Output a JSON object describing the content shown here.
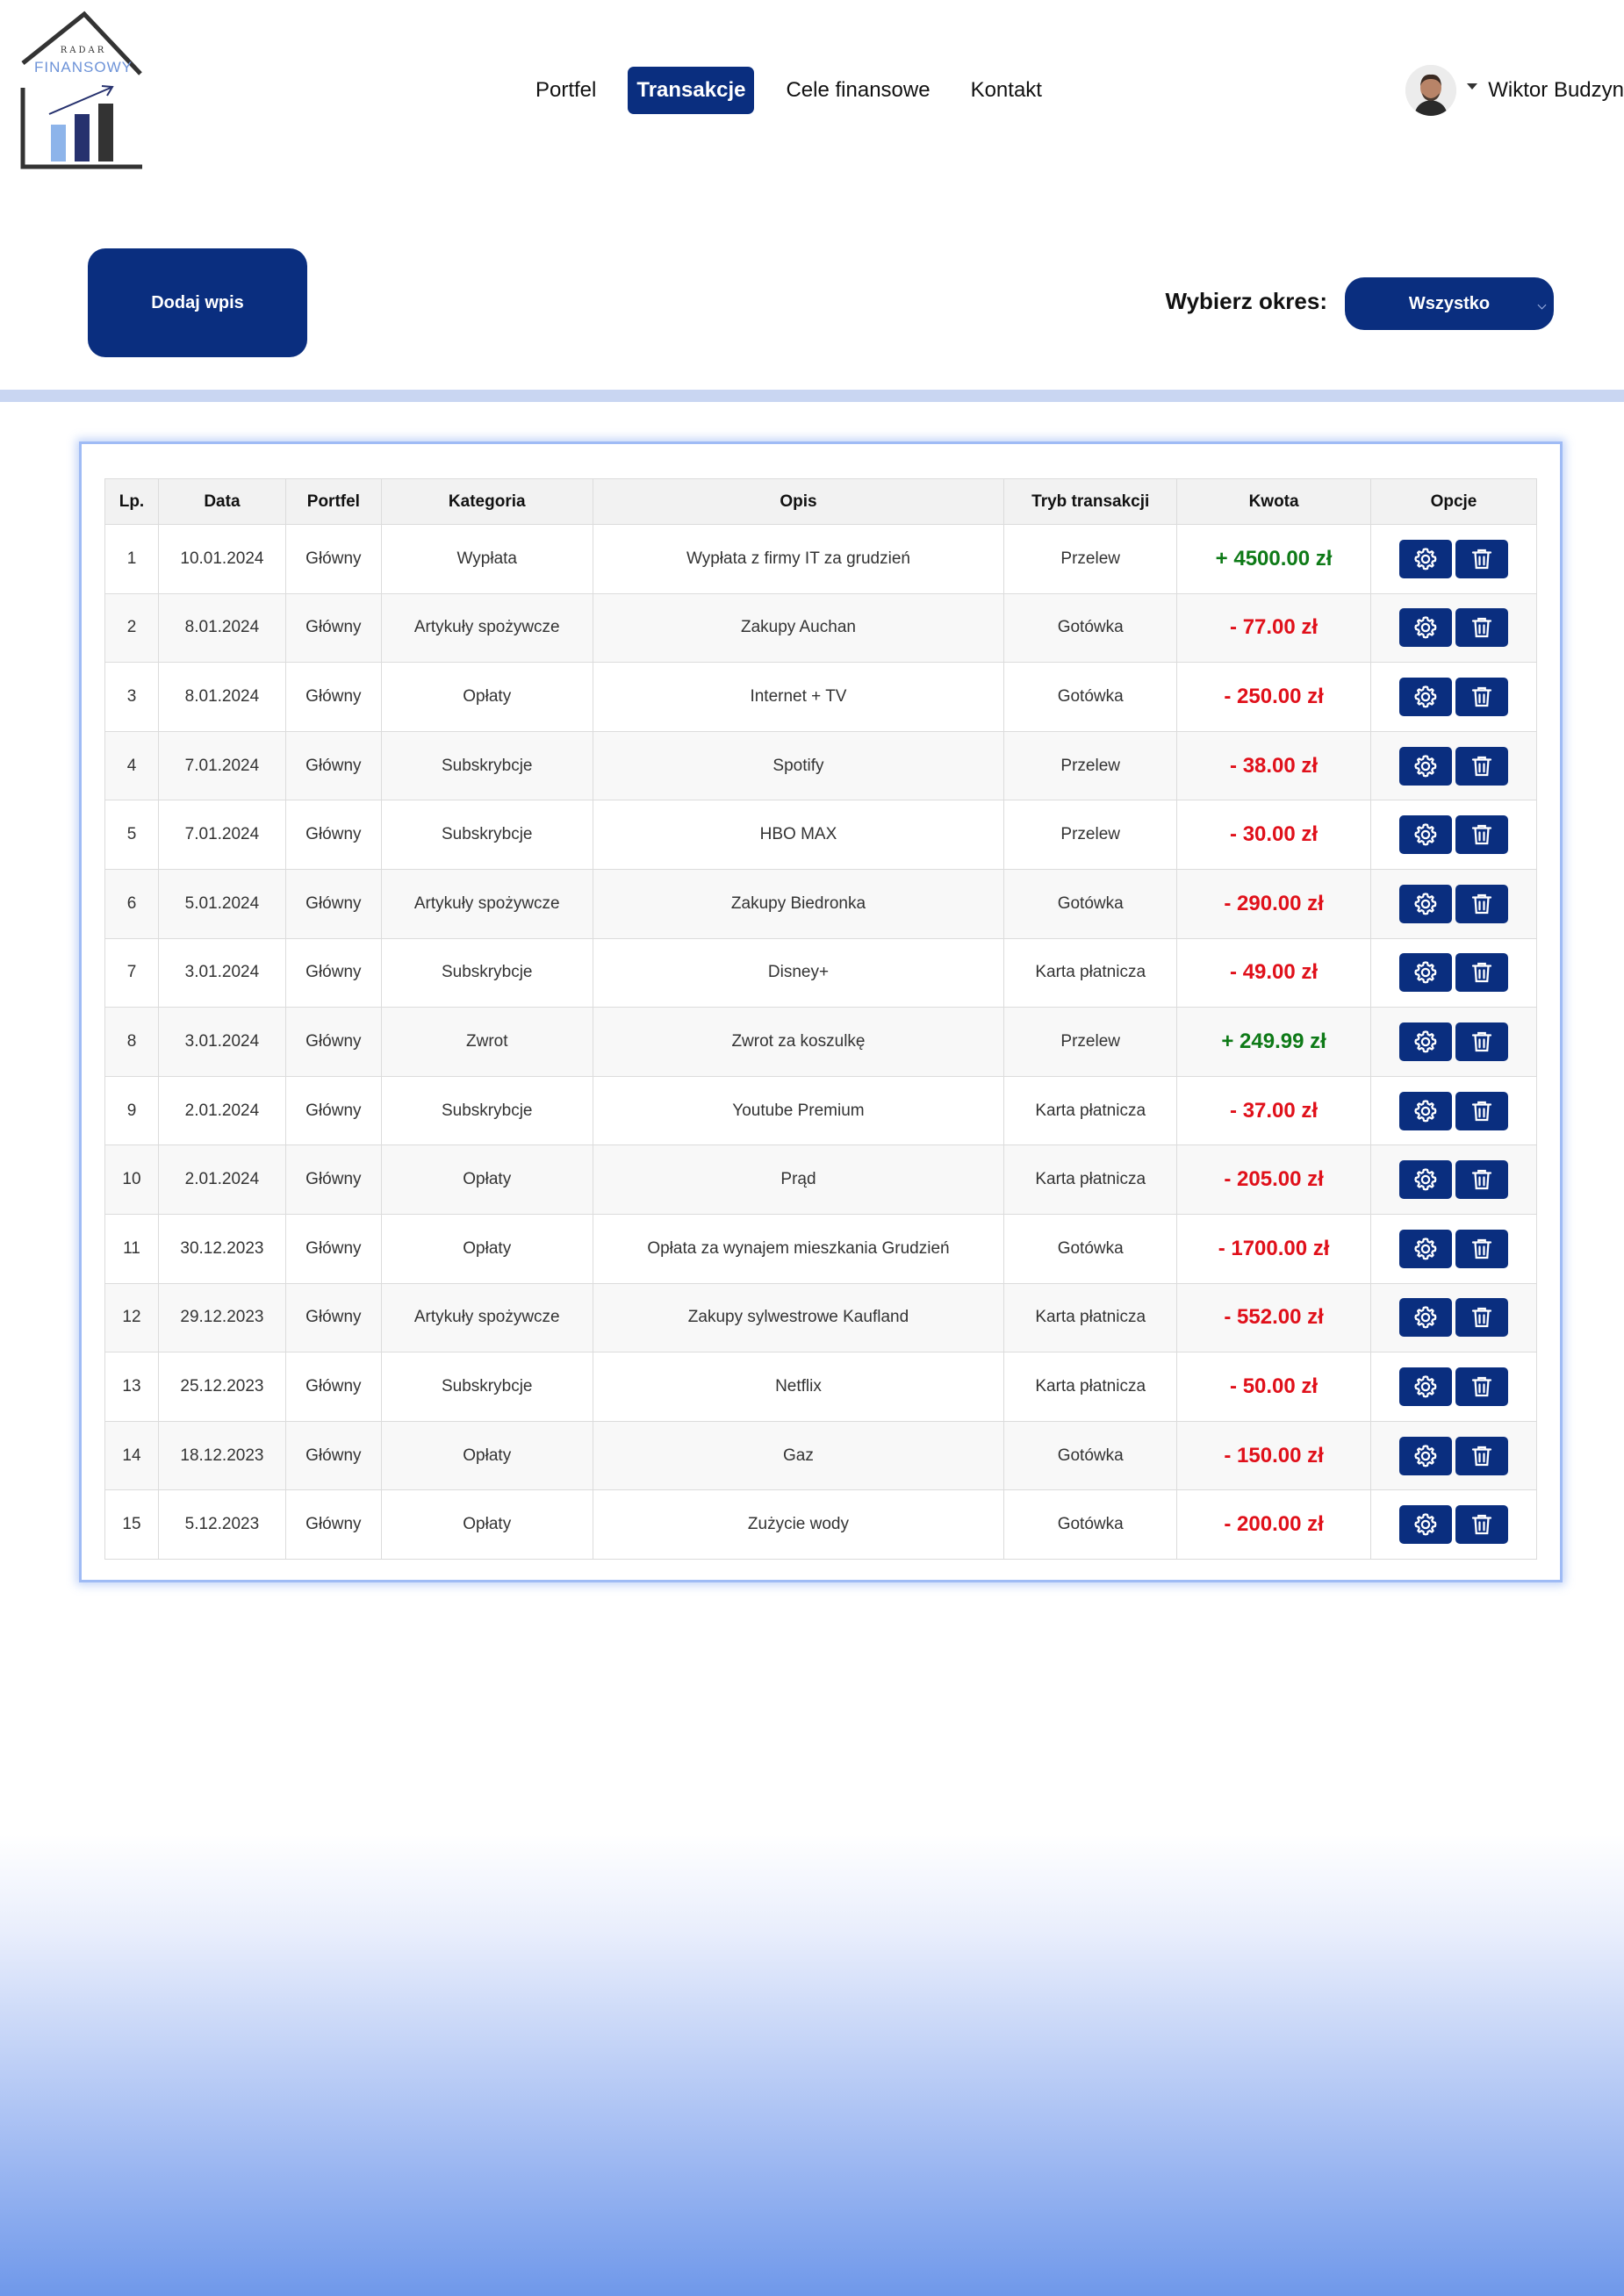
{
  "logo": {
    "top_text": "RADAR",
    "brand_text": "FINANSOWY"
  },
  "nav": {
    "items": [
      {
        "label": "Portfel",
        "active": false
      },
      {
        "label": "Transakcje",
        "active": true
      },
      {
        "label": "Cele finansowe",
        "active": false
      },
      {
        "label": "Kontakt",
        "active": false
      }
    ]
  },
  "user": {
    "name": "Wiktor Budzyn",
    "avatar_icon": "user-avatar"
  },
  "controls": {
    "add_label": "Dodaj wpis",
    "period_label": "Wybierz okres:",
    "period_selected": "Wszystko"
  },
  "colors": {
    "primary": "#0a2e7f",
    "positive": "#0e7a17",
    "negative": "#e0101a",
    "divider": "#c9d6f2"
  },
  "table": {
    "headers": [
      "Lp.",
      "Data",
      "Portfel",
      "Kategoria",
      "Opis",
      "Tryb transakcji",
      "Kwota",
      "Opcje"
    ],
    "rows": [
      {
        "lp": "1",
        "date": "10.01.2024",
        "wallet": "Główny",
        "category": "Wypłata",
        "desc": "Wypłata z firmy IT za grudzień",
        "mode": "Przelew",
        "amount": "+ 4500.00 zł",
        "sign": "pos"
      },
      {
        "lp": "2",
        "date": "8.01.2024",
        "wallet": "Główny",
        "category": "Artykuły spożywcze",
        "desc": "Zakupy Auchan",
        "mode": "Gotówka",
        "amount": "- 77.00 zł",
        "sign": "neg"
      },
      {
        "lp": "3",
        "date": "8.01.2024",
        "wallet": "Główny",
        "category": "Opłaty",
        "desc": "Internet + TV",
        "mode": "Gotówka",
        "amount": "- 250.00 zł",
        "sign": "neg"
      },
      {
        "lp": "4",
        "date": "7.01.2024",
        "wallet": "Główny",
        "category": "Subskrybcje",
        "desc": "Spotify",
        "mode": "Przelew",
        "amount": "- 38.00 zł",
        "sign": "neg"
      },
      {
        "lp": "5",
        "date": "7.01.2024",
        "wallet": "Główny",
        "category": "Subskrybcje",
        "desc": "HBO MAX",
        "mode": "Przelew",
        "amount": "- 30.00 zł",
        "sign": "neg"
      },
      {
        "lp": "6",
        "date": "5.01.2024",
        "wallet": "Główny",
        "category": "Artykuły spożywcze",
        "desc": "Zakupy Biedronka",
        "mode": "Gotówka",
        "amount": "- 290.00 zł",
        "sign": "neg"
      },
      {
        "lp": "7",
        "date": "3.01.2024",
        "wallet": "Główny",
        "category": "Subskrybcje",
        "desc": "Disney+",
        "mode": "Karta płatnicza",
        "amount": "- 49.00 zł",
        "sign": "neg"
      },
      {
        "lp": "8",
        "date": "3.01.2024",
        "wallet": "Główny",
        "category": "Zwrot",
        "desc": "Zwrot za koszulkę",
        "mode": "Przelew",
        "amount": "+ 249.99 zł",
        "sign": "pos"
      },
      {
        "lp": "9",
        "date": "2.01.2024",
        "wallet": "Główny",
        "category": "Subskrybcje",
        "desc": "Youtube Premium",
        "mode": "Karta płatnicza",
        "amount": "- 37.00 zł",
        "sign": "neg"
      },
      {
        "lp": "10",
        "date": "2.01.2024",
        "wallet": "Główny",
        "category": "Opłaty",
        "desc": "Prąd",
        "mode": "Karta płatnicza",
        "amount": "- 205.00 zł",
        "sign": "neg"
      },
      {
        "lp": "11",
        "date": "30.12.2023",
        "wallet": "Główny",
        "category": "Opłaty",
        "desc": "Opłata za wynajem mieszkania Grudzień",
        "mode": "Gotówka",
        "amount": "- 1700.00 zł",
        "sign": "neg"
      },
      {
        "lp": "12",
        "date": "29.12.2023",
        "wallet": "Główny",
        "category": "Artykuły spożywcze",
        "desc": "Zakupy sylwestrowe Kaufland",
        "mode": "Karta płatnicza",
        "amount": "- 552.00 zł",
        "sign": "neg"
      },
      {
        "lp": "13",
        "date": "25.12.2023",
        "wallet": "Główny",
        "category": "Subskrybcje",
        "desc": "Netflix",
        "mode": "Karta płatnicza",
        "amount": "- 50.00 zł",
        "sign": "neg"
      },
      {
        "lp": "14",
        "date": "18.12.2023",
        "wallet": "Główny",
        "category": "Opłaty",
        "desc": "Gaz",
        "mode": "Gotówka",
        "amount": "- 150.00 zł",
        "sign": "neg"
      },
      {
        "lp": "15",
        "date": "5.12.2023",
        "wallet": "Główny",
        "category": "Opłaty",
        "desc": "Zużycie wody",
        "mode": "Gotówka",
        "amount": "- 200.00 zł",
        "sign": "neg"
      }
    ],
    "row_actions": [
      {
        "name": "settings",
        "icon": "gear-icon"
      },
      {
        "name": "delete",
        "icon": "trash-icon"
      }
    ]
  }
}
